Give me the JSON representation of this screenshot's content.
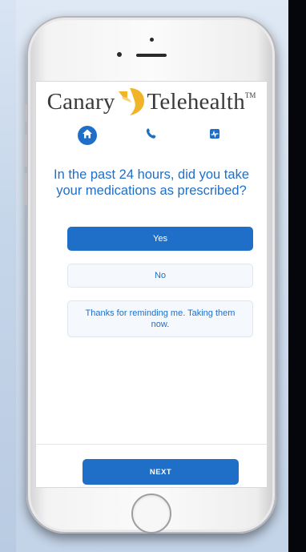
{
  "logo": {
    "left_word": "Canary",
    "right_word": "Telehealth",
    "trademark": "TM"
  },
  "nav": {
    "items": [
      {
        "icon": "home-icon",
        "active": true
      },
      {
        "icon": "phone-icon",
        "active": false
      },
      {
        "icon": "vitals-monitor-icon",
        "active": false
      }
    ]
  },
  "survey": {
    "question": "In the past 24 hours, did you take your medications as prescribed?",
    "options": [
      {
        "label": "Yes",
        "selected": true
      },
      {
        "label": "No",
        "selected": false
      },
      {
        "label": "Thanks for reminding me. Taking them now.",
        "selected": false
      }
    ]
  },
  "footer": {
    "next_label": "NEXT"
  },
  "colors": {
    "primary": "#1f6fc8",
    "option_bg": "#f5f8fc",
    "logo_yellow": "#f0b429"
  }
}
